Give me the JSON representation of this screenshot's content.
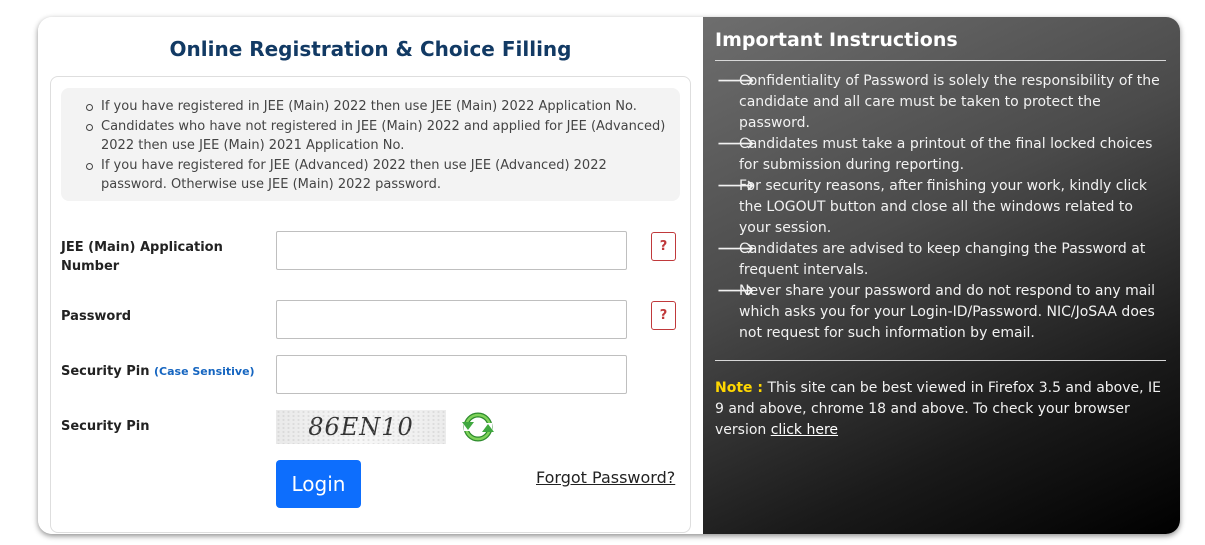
{
  "form": {
    "title": "Online Registration & Choice Filling",
    "notes": [
      "If you have registered in JEE (Main) 2022 then use JEE (Main) 2022 Application No.",
      "Candidates who have not registered in JEE (Main) 2022 and applied for JEE (Advanced) 2022 then use JEE (Main) 2021 Application No.",
      "If you have registered for JEE (Advanced) 2022 then use JEE (Advanced) 2022 password. Otherwise use JEE (Main) 2022 password."
    ],
    "application_label": "JEE (Main) Application Number",
    "password_label": "Password",
    "security_pin_label": "Security Pin",
    "case_sensitive": "(Case Sensitive)",
    "security_pin_image_label": "Security Pin",
    "help": "?",
    "captcha_text": "86EN10",
    "login": "Login",
    "forgot": "Forgot Password?"
  },
  "instructions": {
    "title": "Important Instructions",
    "arrow": "🡒",
    "items": [
      "Confidentiality of Password is solely the responsibility of the candidate and all care must be taken to protect the password.",
      "Candidates must take a printout of the final locked choices for submission during reporting.",
      "For security reasons, after finishing your work, kindly click the LOGOUT button and close all the windows related to your session.",
      "Candidates are advised to keep changing the Password at frequent intervals.",
      "Never share your password and do not respond to any mail which asks you for your Login-ID/Password. NIC/JoSAA does not request for such information by email."
    ],
    "note_label": "Note :",
    "note_text": " This site can be best viewed in Firefox 3.5 and above, IE 9 and above, chrome 18 and above. To check your browser version ",
    "note_link": "click here"
  },
  "colors": {
    "title": "#123a64",
    "login": "#0d6efd",
    "note_label": "#ffd700",
    "help": "#c0393b"
  }
}
